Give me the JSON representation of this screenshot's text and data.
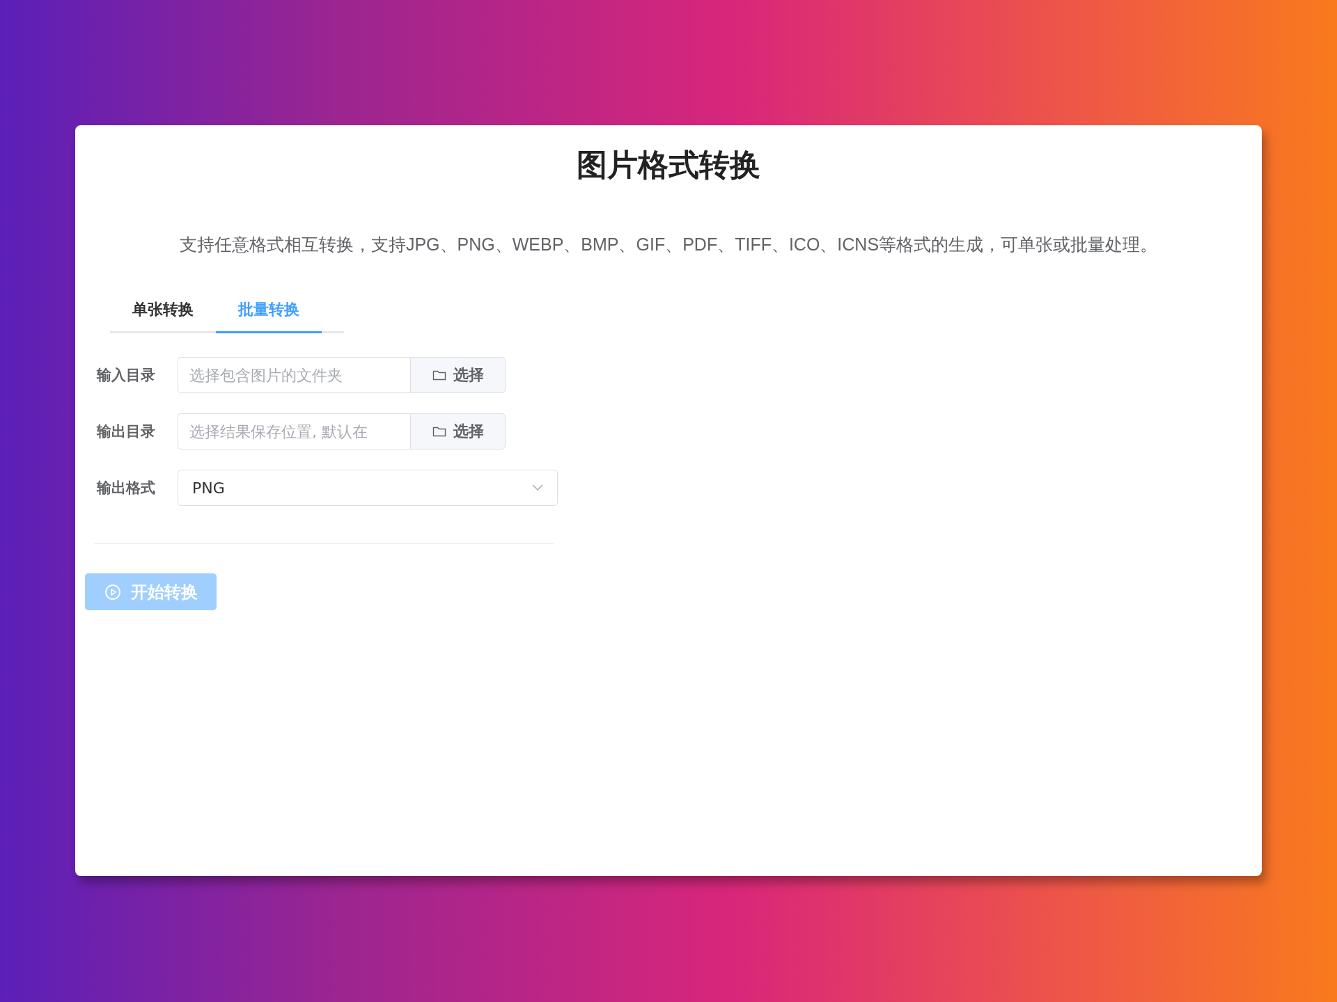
{
  "title": "图片格式转换",
  "description": "支持任意格式相互转换，支持JPG、PNG、WEBP、BMP、GIF、PDF、TIFF、ICO、ICNS等格式的生成，可单张或批量处理。",
  "tabs": [
    {
      "label": "单张转换",
      "selected": false
    },
    {
      "label": "批量转换",
      "selected": true
    }
  ],
  "form": [
    {
      "kind": "folder",
      "label": "输入目录",
      "placeholder": "选择包含图片的文件夹",
      "button": "选择"
    },
    {
      "kind": "folder",
      "label": "输出目录",
      "placeholder": "选择结果保存位置, 默认在",
      "button": "选择"
    },
    {
      "kind": "select",
      "label": "输出格式",
      "value": "PNG"
    }
  ],
  "start_button": {
    "label": "开始转换",
    "disabled": true
  }
}
